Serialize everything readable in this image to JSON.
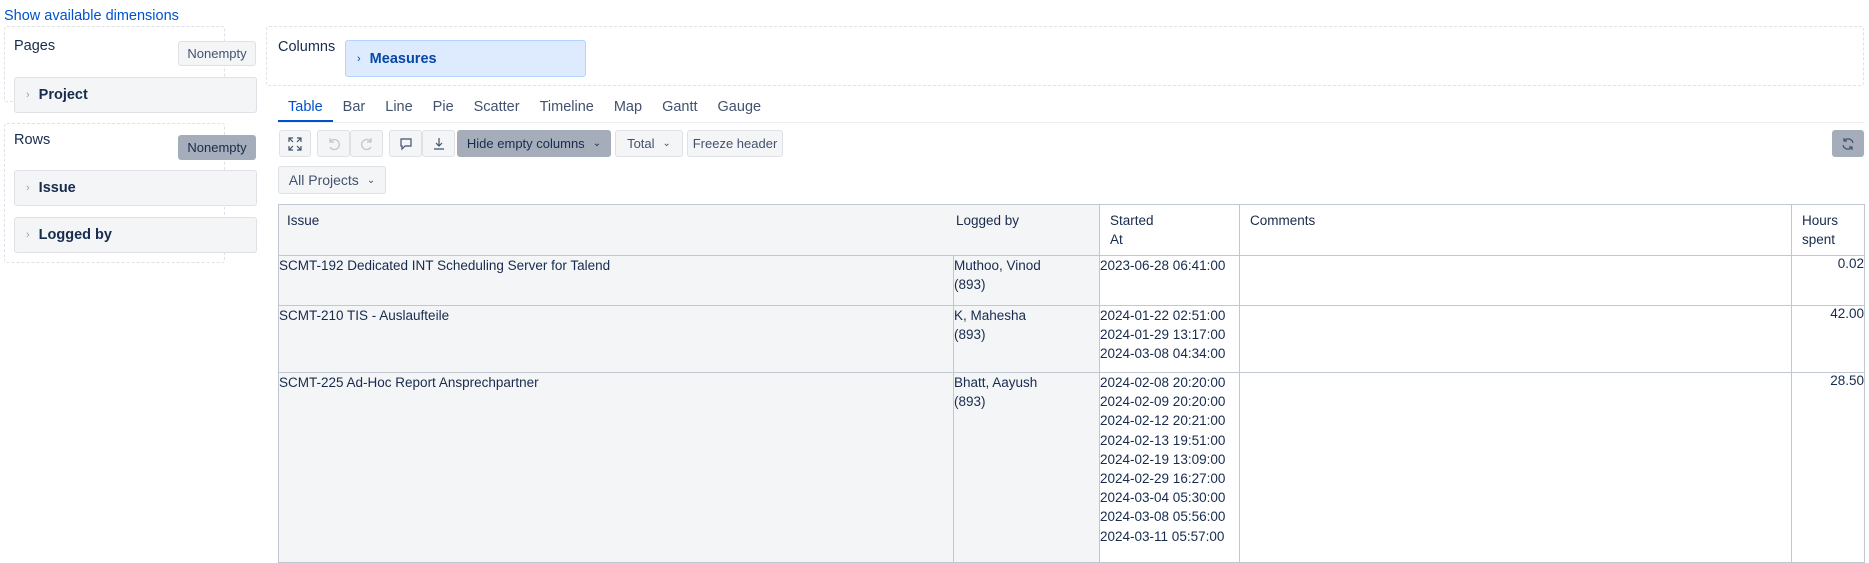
{
  "top_link": "Show available dimensions",
  "pages_panel": {
    "title": "Pages",
    "nonempty": "Nonempty",
    "items": [
      {
        "label": "Project"
      }
    ]
  },
  "rows_panel": {
    "title": "Rows",
    "nonempty": "Nonempty",
    "items": [
      {
        "label": "Issue"
      },
      {
        "label": "Logged by"
      }
    ]
  },
  "columns_panel": {
    "title": "Columns",
    "items": [
      {
        "label": "Measures"
      }
    ]
  },
  "chart_tabs": [
    "Table",
    "Bar",
    "Line",
    "Pie",
    "Scatter",
    "Timeline",
    "Map",
    "Gantt",
    "Gauge"
  ],
  "active_tab": "Table",
  "toolbar": {
    "hide_empty_columns": "Hide empty columns",
    "total": "Total",
    "freeze_header": "Freeze header"
  },
  "project_filter": "All Projects",
  "table": {
    "headers": {
      "issue": "Issue",
      "logged_by": "Logged by",
      "started_line1": "Started",
      "started_line2": "At",
      "comments": "Comments",
      "hours_line1": "Hours",
      "hours_line2": "spent"
    },
    "rows": [
      {
        "issue": "SCMT-192 Dedicated INT Scheduling Server for Talend",
        "logged_by_line1": "Muthoo, Vinod",
        "logged_by_line2": "(893)",
        "started": [
          "2023-06-28 06:41:00"
        ],
        "comments": "",
        "hours": "0.02"
      },
      {
        "issue": "SCMT-210 TIS - Auslaufteile",
        "logged_by_line1": "K, Mahesha",
        "logged_by_line2": "(893)",
        "started": [
          "2024-01-22 02:51:00",
          "2024-01-29 13:17:00",
          "2024-03-08 04:34:00"
        ],
        "comments": "",
        "hours": "42.00"
      },
      {
        "issue": "SCMT-225 Ad-Hoc Report Ansprechpartner",
        "logged_by_line1": "Bhatt, Aayush",
        "logged_by_line2": "(893)",
        "started": [
          "2024-02-08 20:20:00",
          "2024-02-09 20:20:00",
          "2024-02-12 20:21:00",
          "2024-02-13 19:51:00",
          "2024-02-19 13:09:00",
          "2024-02-29 16:27:00",
          "2024-03-04 05:30:00",
          "2024-03-08 05:56:00",
          "2024-03-11 05:57:00"
        ],
        "comments": "",
        "hours": "28.50"
      }
    ]
  },
  "colors": {
    "link": "#0052cc",
    "measures_bg": "#deebff",
    "active_button": "#a5adba",
    "panel_bg": "#f4f5f7"
  }
}
